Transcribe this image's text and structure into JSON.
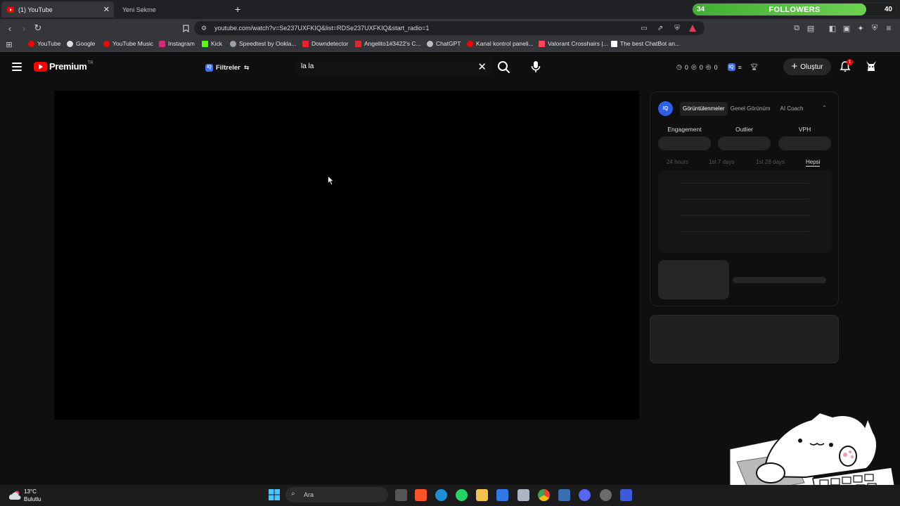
{
  "browser": {
    "tabs": [
      {
        "label": "(1) YouTube",
        "active": true
      },
      {
        "label": "Yeni Sekme",
        "active": false
      }
    ],
    "url": "youtube.com/watch?v=Se237UXFKIQ&list=RDSe237UXFKIQ&start_radio=1",
    "bookmarks": [
      {
        "label": "YouTube",
        "color": "#ff0000"
      },
      {
        "label": "Google",
        "color": "#dddddd"
      },
      {
        "label": "YouTube Music",
        "color": "#ff0000"
      },
      {
        "label": "Instagram",
        "color": "#d62976"
      },
      {
        "label": "Kick",
        "color": "#53fc18"
      },
      {
        "label": "Speedtest by Ookla...",
        "color": "#9aa0a6"
      },
      {
        "label": "Downdetector",
        "color": "#e4242c"
      },
      {
        "label": "Angelito1#3422's C...",
        "color": "#e4242c"
      },
      {
        "label": "ChatGPT",
        "color": "#bbbbbb"
      },
      {
        "label": "Kanal kontrol paneli...",
        "color": "#ff0000"
      },
      {
        "label": "Valorant Crosshairs |...",
        "color": "#ff4655"
      },
      {
        "label": "The best ChatBot an...",
        "color": "#ffffff"
      }
    ]
  },
  "followers_widget": {
    "current": "34",
    "label": "FOLLOWERS",
    "goal": "40",
    "progress": 0.85
  },
  "youtube": {
    "logo_text": "Premium",
    "region": "TR",
    "filters_label": "Filtreler",
    "search_value": "la la",
    "stats": [
      "0",
      "0",
      "0"
    ],
    "create_label": "Oluştur",
    "notification_count": "1"
  },
  "side_panel": {
    "tabs": [
      {
        "label": "Görüntülenmeler",
        "active": true
      },
      {
        "label": "Genel Görünüm",
        "active": false
      },
      {
        "label": "AI Coach",
        "active": false
      }
    ],
    "metrics": [
      "Engagement",
      "Outlier",
      "VPH"
    ],
    "ranges": [
      {
        "label": "24 hours",
        "active": false
      },
      {
        "label": "1st 7 days",
        "active": false
      },
      {
        "label": "1st 28 days",
        "active": false
      },
      {
        "label": "Hepsi",
        "active": true
      }
    ]
  },
  "taskbar": {
    "weather_temp": "13°C",
    "weather_desc": "Bulutlu",
    "search_placeholder": "Ara"
  },
  "colors": {
    "accent_red": "#ff0000",
    "followers_green": "#4cbf3b",
    "iq_blue": "#2d5fe8"
  }
}
